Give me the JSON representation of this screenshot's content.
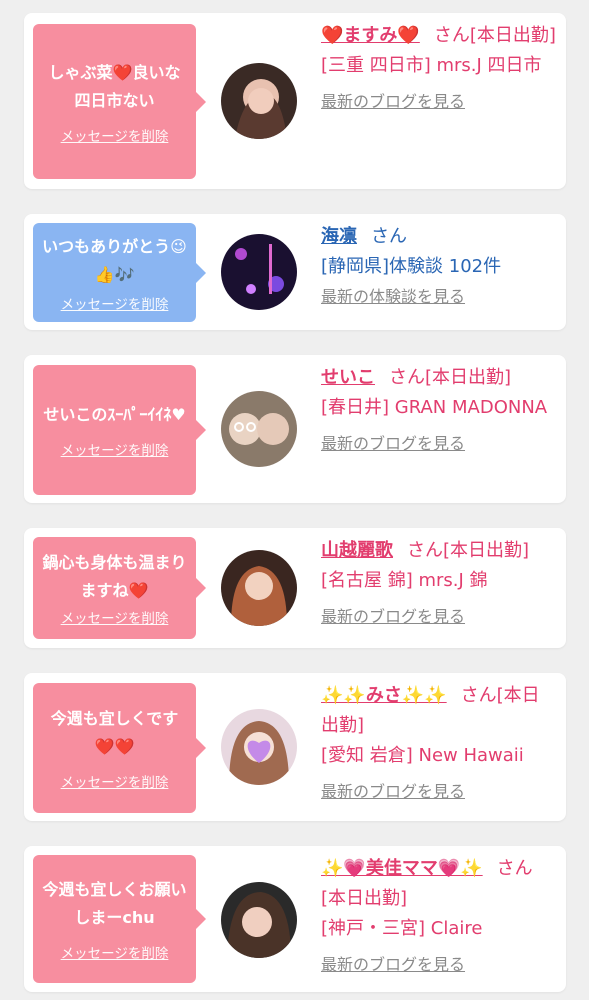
{
  "items": [
    {
      "message": "しゃぶ菜❤️良いな四日市ない",
      "delete_label": "メッセージを削除",
      "name": "❤️ますみ❤️",
      "suffix": "さん[本日出勤]",
      "store": "[三重 四日市] mrs.J 四日市",
      "link": "最新のブログを見る",
      "theme": "pink"
    },
    {
      "message": "いつもありがとう😉👍🎶",
      "delete_label": "メッセージを削除",
      "name": "海凛",
      "suffix": "さん",
      "store": "[静岡県]体験談 102件",
      "link": "最新の体験談を見る",
      "theme": "blue"
    },
    {
      "message": "せいこのｽｰﾊﾟｰｲｲﾈ♥",
      "delete_label": "メッセージを削除",
      "name": "せいこ",
      "suffix": "さん[本日出勤]",
      "store": "[春日井] GRAN MADONNA",
      "link": "最新のブログを見る",
      "theme": "pink"
    },
    {
      "message": "鍋心も身体も温まりますね❤️",
      "delete_label": "メッセージを削除",
      "name": "山越麗歌",
      "suffix": "さん[本日出勤]",
      "store": "[名古屋 錦] mrs.J 錦",
      "link": "最新のブログを見る",
      "theme": "pink"
    },
    {
      "message": "今週も宜しくです❤️❤️",
      "delete_label": "メッセージを削除",
      "name": "✨✨みさ✨✨",
      "suffix": "さん[本日出勤]",
      "store": "[愛知 岩倉] New Hawaii",
      "link": "最新のブログを見る",
      "theme": "pink"
    },
    {
      "message": "今週も宜しくお願いしまーchu",
      "delete_label": "メッセージを削除",
      "name": "✨💗美佳ママ💗✨",
      "suffix": "さん[本日出勤]",
      "store": "[神戸・三宮] Claire",
      "link": "最新のブログを見る",
      "theme": "pink"
    }
  ],
  "colors": {
    "pink_bubble": "#f78e9f",
    "blue_bubble": "#8ab5f2",
    "pink_text": "#e23d6e",
    "blue_text": "#2a66b4"
  }
}
